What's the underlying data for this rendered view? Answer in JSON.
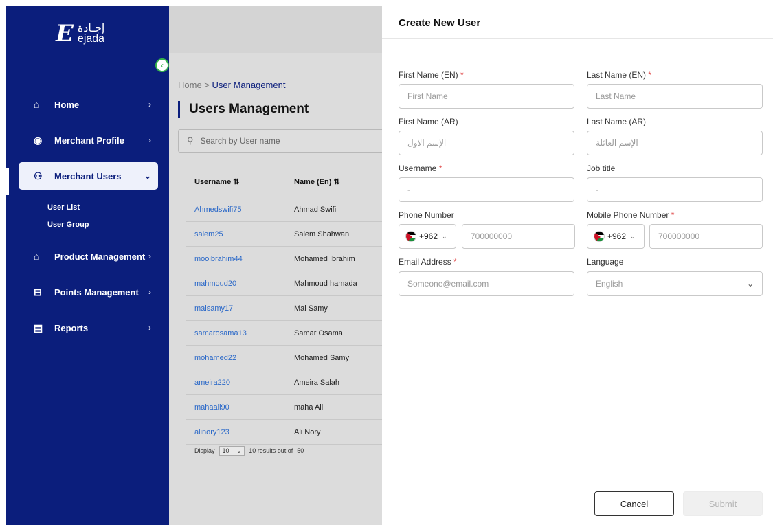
{
  "logo": {
    "mark": "E",
    "arabic": "إجـادة",
    "english": "ejada"
  },
  "sidebar": {
    "collapse_icon": "chevron-left-icon",
    "items": [
      {
        "label": "Home",
        "icon": "home-icon",
        "glyph": "⌂"
      },
      {
        "label": "Merchant Profile",
        "icon": "profile-icon",
        "glyph": "◉"
      },
      {
        "label": "Merchant Users",
        "icon": "users-icon",
        "glyph": "⚇"
      },
      {
        "label": "Product Management",
        "icon": "product-icon",
        "glyph": "⌂"
      },
      {
        "label": "Points Management",
        "icon": "points-icon",
        "glyph": "⊟"
      },
      {
        "label": "Reports",
        "icon": "reports-icon",
        "glyph": "▤"
      }
    ],
    "sub_items": [
      "User List",
      "User Group"
    ]
  },
  "main": {
    "breadcrumb": {
      "root": "Home",
      "sep": " > ",
      "current": "User Management"
    },
    "title": "Users Management",
    "search_placeholder": "Search by User name",
    "table": {
      "headers": [
        "Username ⇅",
        "Name (En) ⇅"
      ],
      "rows": [
        [
          "Ahmedswifi75",
          "Ahmad Swifi"
        ],
        [
          "salem25",
          "Salem Shahwan"
        ],
        [
          "mooibrahim44",
          "Mohamed Ibrahim"
        ],
        [
          "mahmoud20",
          "Mahmoud hamada"
        ],
        [
          "maisamy17",
          "Mai Samy"
        ],
        [
          "samarosama13",
          "Samar Osama"
        ],
        [
          "mohamed22",
          "Mohamed Samy"
        ],
        [
          "ameira220",
          "Ameira Salah"
        ],
        [
          "mahaali90",
          "maha Ali"
        ],
        [
          "alinory123",
          "Ali Nory"
        ]
      ]
    },
    "pager": {
      "display": "Display",
      "page_size": "10",
      "results": "10 results out of",
      "total": "50"
    }
  },
  "drawer": {
    "title": "Create New User",
    "fields": {
      "first_name_en": {
        "label": "First Name (EN)",
        "placeholder": "First Name",
        "required": "*"
      },
      "last_name_en": {
        "label": "Last Name (EN)",
        "placeholder": "Last Name",
        "required": "*"
      },
      "first_name_ar": {
        "label": "First Name (AR)",
        "placeholder": "الإسم الاول"
      },
      "last_name_ar": {
        "label": "Last Name (AR)",
        "placeholder": "الإسم العائلة"
      },
      "username": {
        "label": "Username",
        "placeholder": "-",
        "required": "*"
      },
      "job_title": {
        "label": "Job title",
        "placeholder": "-"
      },
      "phone": {
        "label": "Phone Number",
        "code": "+962",
        "placeholder": "700000000"
      },
      "mobile": {
        "label": "Mobile Phone Number",
        "code": "+962",
        "placeholder": "700000000",
        "required": "*"
      },
      "email": {
        "label": "Email Address",
        "placeholder": "Someone@email.com",
        "required": "*"
      },
      "language": {
        "label": "Language",
        "value": "English"
      }
    },
    "cancel": "Cancel",
    "submit": "Submit"
  }
}
